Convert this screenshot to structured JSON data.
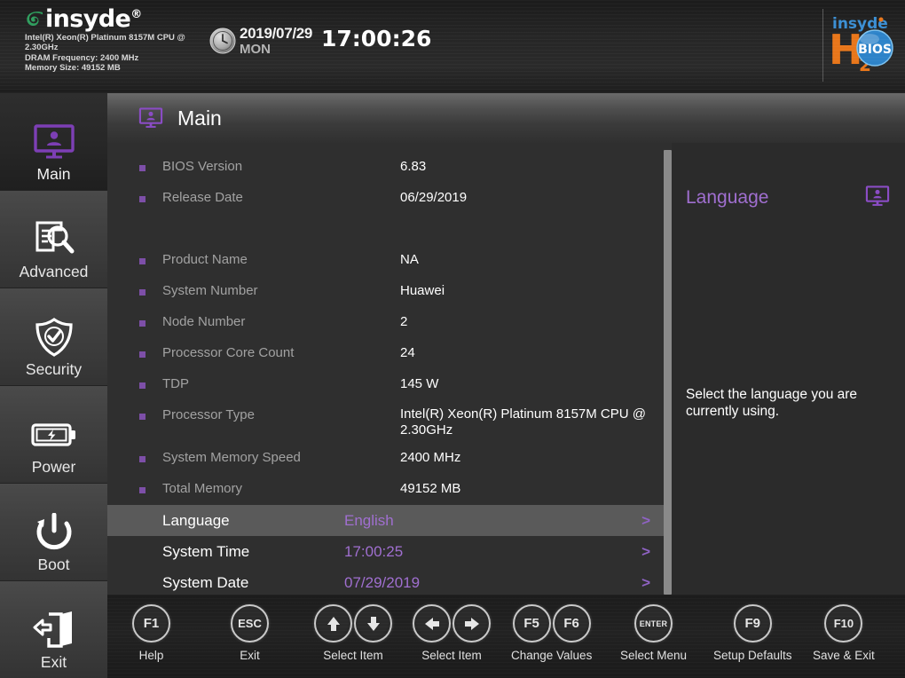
{
  "banner": {
    "vendor_logo_text": "insyde",
    "vendor_logo_tm": "®",
    "system_info_lines": [
      "Intel(R) Xeon(R) Platinum 8157M CPU @ 2.30GHz",
      "DRAM Frequency: 2400 MHz",
      "Memory Size: 49152 MB"
    ],
    "clock_icon": "clock-icon",
    "date": "2019/07/29",
    "weekday": "MON",
    "time": "17:00:26",
    "brand_logo": {
      "top": "insyde",
      "main": "H",
      "sub": "2",
      "o_badge": "BIOS"
    }
  },
  "sidebar": {
    "items": [
      {
        "label": "Main",
        "icon": "monitor-user-icon",
        "active": true
      },
      {
        "label": "Advanced",
        "icon": "magnifier-doc-icon",
        "active": false
      },
      {
        "label": "Security",
        "icon": "shield-check-icon",
        "active": false
      },
      {
        "label": "Power",
        "icon": "battery-bolt-icon",
        "active": false
      },
      {
        "label": "Boot",
        "icon": "power-cycle-icon",
        "active": false
      },
      {
        "label": "Exit",
        "icon": "exit-door-icon",
        "active": false
      }
    ]
  },
  "page_header": {
    "title": "Main",
    "icon": "monitor-user-icon"
  },
  "main": {
    "info_rows": [
      {
        "label": "BIOS Version",
        "value": "6.83"
      },
      {
        "label": "Release Date",
        "value": "06/29/2019"
      },
      {
        "label": "Product Name",
        "value": "NA"
      },
      {
        "label": "System Number",
        "value": "Huawei"
      },
      {
        "label": "Node Number",
        "value": "2"
      },
      {
        "label": "Processor Core Count",
        "value": "24"
      },
      {
        "label": "TDP",
        "value": "145 W"
      },
      {
        "label": "Processor Type",
        "value": "Intel(R) Xeon(R) Platinum 8157M CPU @ 2.30GHz"
      },
      {
        "label": "System Memory Speed",
        "value": "2400 MHz"
      },
      {
        "label": "Total Memory",
        "value": "49152 MB"
      }
    ],
    "setting_rows": [
      {
        "label": "Language",
        "value": "English",
        "chevron": ">",
        "selected": true
      },
      {
        "label": "System Time",
        "value": "17:00:25",
        "chevron": ">",
        "selected": false
      },
      {
        "label": "System Date",
        "value": "07/29/2019",
        "chevron": ">",
        "selected": false
      }
    ]
  },
  "help_panel": {
    "title": "Language",
    "icon": "monitor-user-icon",
    "description": "Select the language you are currently using."
  },
  "function_bar": {
    "groups": [
      {
        "keys": [
          "F1"
        ],
        "label": "Help"
      },
      {
        "keys": [
          "ESC"
        ],
        "label": "Exit"
      },
      {
        "keys": [
          "up",
          "down"
        ],
        "label": "Select Item"
      },
      {
        "keys": [
          "left",
          "right"
        ],
        "label": "Select Item"
      },
      {
        "keys": [
          "F5",
          "F6"
        ],
        "label": "Change Values"
      },
      {
        "keys": [
          "ENTER"
        ],
        "label": "Select Menu"
      },
      {
        "keys": [
          "F9"
        ],
        "label": "Setup Defaults"
      },
      {
        "keys": [
          "F10"
        ],
        "label": "Save & Exit"
      }
    ]
  },
  "colors": {
    "accent_purple": "#a06fd0",
    "bullet_purple": "#7d4fa8",
    "logo_green": "#2f9e5e",
    "logo_orange": "#e8761a",
    "logo_blue": "#2d83c9",
    "selected_row_bg": "#5a5a5a"
  }
}
